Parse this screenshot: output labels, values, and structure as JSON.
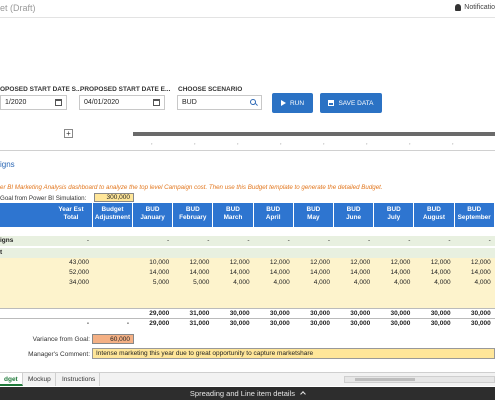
{
  "header": {
    "app_title": "et (Draft)",
    "notifications_label": "Notificatio"
  },
  "form": {
    "start_date_1": {
      "label": "OPOSED START DATE S...",
      "value": "1/2020"
    },
    "start_date_2": {
      "label": "PROPOSED START DATE E...",
      "value": "04/01/2020"
    },
    "scenario": {
      "label": "CHOOSE SCENARIO",
      "value": "BUD"
    },
    "run_label": "RUN",
    "save_label": "SAVE DATA"
  },
  "toolbar": {
    "expand_symbol": "+"
  },
  "section": {
    "title": "igns",
    "instruction": "er BI Marketing Analysis dashboard to analyze the top level Campaign cost. Then use this Budget template to generate the detailed Budget.",
    "goal_label": "Goal from Power BI Simulation:",
    "goal_value": "300,000"
  },
  "table": {
    "headers": {
      "year_est": [
        "Year Est",
        "Total"
      ],
      "budget_adj": [
        "Budget",
        "Adjustment"
      ],
      "months": [
        [
          "BUD",
          "January"
        ],
        [
          "BUD",
          "February"
        ],
        [
          "BUD",
          "March"
        ],
        [
          "BUD",
          "April"
        ],
        [
          "BUD",
          "May"
        ],
        [
          "BUD",
          "June"
        ],
        [
          "BUD",
          "July"
        ],
        [
          "BUD",
          "August"
        ],
        [
          "BUD",
          "September"
        ]
      ]
    },
    "rows": [
      {
        "label": "igns",
        "year_est": "-",
        "adj": "",
        "months": [
          "-",
          "-",
          "-",
          "-",
          "-",
          "-",
          "-",
          "-",
          "-"
        ]
      },
      {
        "label": "t",
        "year_est": "",
        "adj": "",
        "months": [
          "",
          "",
          "",
          "",
          "",
          "",
          "",
          "",
          ""
        ]
      },
      {
        "label": "",
        "year_est": "43,000",
        "adj": "",
        "months": [
          "10,000",
          "12,000",
          "12,000",
          "12,000",
          "12,000",
          "12,000",
          "12,000",
          "12,000",
          "12,000"
        ]
      },
      {
        "label": "",
        "year_est": "52,000",
        "adj": "",
        "months": [
          "14,000",
          "14,000",
          "14,000",
          "14,000",
          "14,000",
          "14,000",
          "14,000",
          "14,000",
          "14,000"
        ]
      },
      {
        "label": "",
        "year_est": "34,000",
        "adj": "",
        "months": [
          "5,000",
          "5,000",
          "4,000",
          "4,000",
          "4,000",
          "4,000",
          "4,000",
          "4,000",
          "4,000"
        ]
      },
      {
        "label": "",
        "year_est": "",
        "adj": "",
        "months": [
          "",
          "",
          "",
          "",
          "",
          "",
          "",
          "",
          ""
        ]
      },
      {
        "label": "",
        "year_est": "",
        "adj": "",
        "months": [
          "",
          "",
          "",
          "",
          "",
          "",
          "",
          "",
          ""
        ]
      },
      {
        "label": "",
        "year_est": "",
        "adj": "",
        "months": [
          "29,000",
          "31,000",
          "30,000",
          "30,000",
          "30,000",
          "30,000",
          "30,000",
          "30,000",
          "30,000"
        ]
      },
      {
        "label": "",
        "year_est": "-",
        "adj": "-",
        "months": [
          "29,000",
          "31,000",
          "30,000",
          "30,000",
          "30,000",
          "30,000",
          "30,000",
          "30,000",
          "30,000"
        ]
      }
    ]
  },
  "variance": {
    "label": "Variance from Goal:",
    "value": "60,000"
  },
  "comment": {
    "label": "Manager's Comment:",
    "value": "Intense marketing this year due to great opportunity to capture marketshare"
  },
  "tabs": [
    "dget",
    "Mockup",
    "Instructions"
  ],
  "footer": {
    "label": "Spreading and Line item details"
  },
  "colors": {
    "header_blue": "#2e75d0",
    "input_yellow": "#ffe699",
    "variance_orange": "#f4b084",
    "accent_orange": "#e2761d",
    "button_blue": "#2b72c4"
  }
}
